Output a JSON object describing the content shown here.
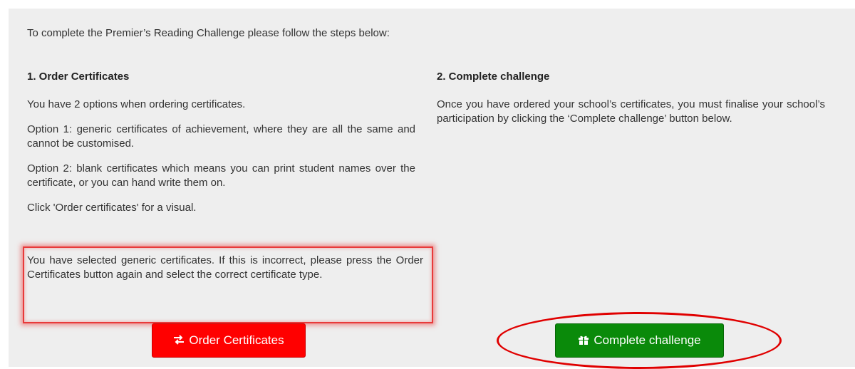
{
  "intro": "To complete the Premier’s Reading Challenge please follow the steps below:",
  "step1": {
    "heading": "1. Order Certificates",
    "paragraphs": [
      "You have 2 options when ordering certificates.",
      "Option 1: generic certificates of achievement, where they are all the same and cannot be customised.",
      "Option 2: blank certificates which means you can print student names over the certificate, or you can hand write them on.",
      "Click 'Order certificates' for a visual."
    ],
    "selected_note": "You have selected generic certificates. If this is incorrect, please press the Order Certificates button again and select the correct certificate type.",
    "button_label": "Order Certificates",
    "button_icon": "exchange-arrows-icon"
  },
  "step2": {
    "heading": "2. Complete challenge",
    "paragraph": "Once you have ordered your school’s certificates, you must finalise your school’s participation by clicking the ‘Complete challenge’ button below.",
    "button_label": "Complete challenge",
    "button_icon": "gift-icon"
  },
  "colors": {
    "panel_bg": "#eeeeee",
    "order_button": "#ff0000",
    "complete_button": "#0a8a0a",
    "annotation": "#e00000"
  }
}
